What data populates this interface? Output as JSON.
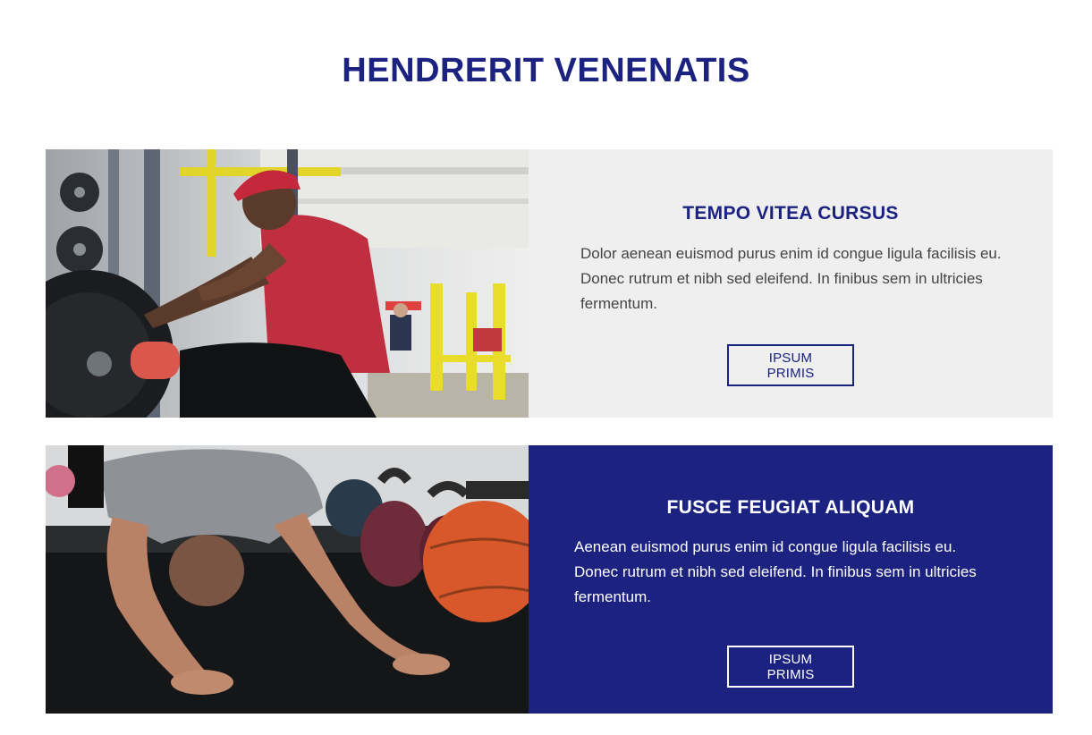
{
  "section": {
    "title": "HENDRERIT VENENATIS"
  },
  "cards": [
    {
      "title": "TEMPO VITEA CURSUS",
      "text": "Dolor aenean euismod purus enim id congue ligula facilisis eu. Donec rutrum et nibh sed eleifend. In finibus sem in ultricies fermentum.",
      "button_label": "IPSUM PRIMIS",
      "panel_color": "#efefef",
      "image": "gym-man-red-cap-photo"
    },
    {
      "title": "FUSCE FEUGIAT ALIQUAM",
      "text": "Aenean euismod purus enim id congue ligula facilisis eu. Donec rutrum et nibh sed eleifend. In finibus sem in ultricies fermentum.",
      "button_label": "IPSUM PRIMIS",
      "panel_color": "#1b2280",
      "image": "man-stretching-kettlebells-photo"
    }
  ],
  "colors": {
    "accent": "#1b2280",
    "light_panel": "#efefef",
    "text_gray": "#444444"
  }
}
